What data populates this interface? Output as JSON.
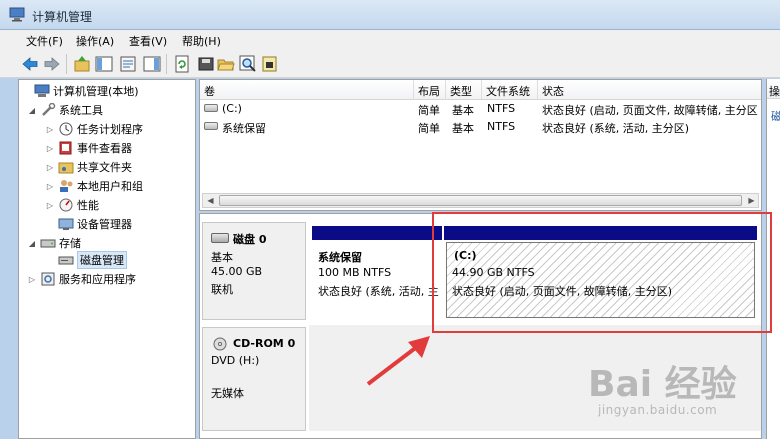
{
  "window": {
    "title": "计算机管理"
  },
  "menu": [
    {
      "label": "文件(F)"
    },
    {
      "label": "操作(A)"
    },
    {
      "label": "查看(V)"
    },
    {
      "label": "帮助(H)"
    }
  ],
  "toolbar": {
    "icons": [
      "back-arrow-icon",
      "forward-arrow-icon",
      "up-folder-icon",
      "show-hide-tree-icon",
      "properties-icon",
      "help-icon",
      "refresh-icon",
      "disk-icon",
      "open-folder-icon",
      "magnify-icon",
      "properties-page-icon"
    ]
  },
  "tree": {
    "items": [
      {
        "label": "计算机管理(本地)",
        "arrow": "",
        "icon": "computer-management-icon"
      },
      {
        "label": "系统工具",
        "arrow": "◢",
        "icon": "system-tools-icon"
      },
      {
        "label": "任务计划程序",
        "arrow": "▷",
        "icon": "task-scheduler-icon"
      },
      {
        "label": "事件查看器",
        "arrow": "▷",
        "icon": "event-viewer-icon"
      },
      {
        "label": "共享文件夹",
        "arrow": "▷",
        "icon": "shared-folders-icon"
      },
      {
        "label": "本地用户和组",
        "arrow": "▷",
        "icon": "local-users-icon"
      },
      {
        "label": "性能",
        "arrow": "▷",
        "icon": "performance-icon"
      },
      {
        "label": "设备管理器",
        "arrow": "",
        "icon": "device-manager-icon"
      },
      {
        "label": "存储",
        "arrow": "◢",
        "icon": "storage-icon"
      },
      {
        "label": "磁盘管理",
        "arrow": "",
        "icon": "disk-management-icon"
      },
      {
        "label": "服务和应用程序",
        "arrow": "▷",
        "icon": "services-apps-icon"
      }
    ]
  },
  "volumes": {
    "columns": [
      "卷",
      "布局",
      "类型",
      "文件系统",
      "状态"
    ],
    "rows": [
      {
        "volume": "(C:)",
        "layout": "简单",
        "type": "基本",
        "fs": "NTFS",
        "status": "状态良好 (启动, 页面文件, 故障转储, 主分区"
      },
      {
        "volume": "系统保留",
        "layout": "简单",
        "type": "基本",
        "fs": "NTFS",
        "status": "状态良好 (系统, 活动, 主分区)"
      }
    ]
  },
  "disks": {
    "disk0": {
      "name": "磁盘 0",
      "type": "基本",
      "size": "45.00 GB",
      "state": "联机",
      "partitions": [
        {
          "name": "系统保留",
          "size": "100 MB NTFS",
          "status": "状态良好 (系统, 活动, 主"
        },
        {
          "name": "(C:)",
          "size": "44.90 GB NTFS",
          "status": "状态良好 (启动, 页面文件, 故障转储, 主分区)"
        }
      ]
    },
    "cdrom0": {
      "name": "CD-ROM 0",
      "type": "DVD (H:)",
      "media": "无媒体"
    }
  },
  "actions": {
    "header": "操",
    "item": "磁"
  },
  "watermark": {
    "logo": "Bai 经验",
    "url": "jingyan.baidu.com"
  },
  "colors": {
    "partition_bar": "#0b0b87",
    "annotation": "#e23b3b"
  }
}
